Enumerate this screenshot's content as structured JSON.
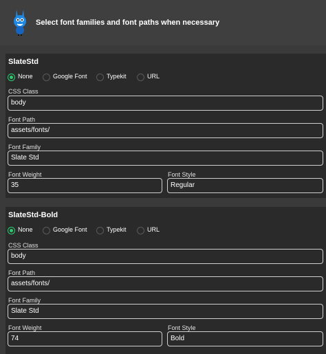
{
  "header": {
    "title": "Select font families and font paths when necessary"
  },
  "colors": {
    "accent": "#2ecc71",
    "panel_bg": "#2a2a2a",
    "page_bg": "#3a3a3a"
  },
  "font_options": [
    "None",
    "Google Font",
    "Typekit",
    "URL"
  ],
  "fonts": [
    {
      "name": "SlateStd",
      "selected_option": "None",
      "labels": {
        "css_class": "CSS Class",
        "font_path": "Font Path",
        "font_family": "Font Family",
        "font_weight": "Font Weight",
        "font_style": "Font Style"
      },
      "values": {
        "css_class": "body",
        "font_path": "assets/fonts/",
        "font_family": "Slate Std",
        "font_weight": "35",
        "font_style": "Regular"
      }
    },
    {
      "name": "SlateStd-Bold",
      "selected_option": "None",
      "labels": {
        "css_class": "CSS Class",
        "font_path": "Font Path",
        "font_family": "Font Family",
        "font_weight": "Font Weight",
        "font_style": "Font Style"
      },
      "values": {
        "css_class": "body",
        "font_path": "assets/fonts/",
        "font_family": "Slate Std",
        "font_weight": "74",
        "font_style": "Bold"
      }
    }
  ]
}
